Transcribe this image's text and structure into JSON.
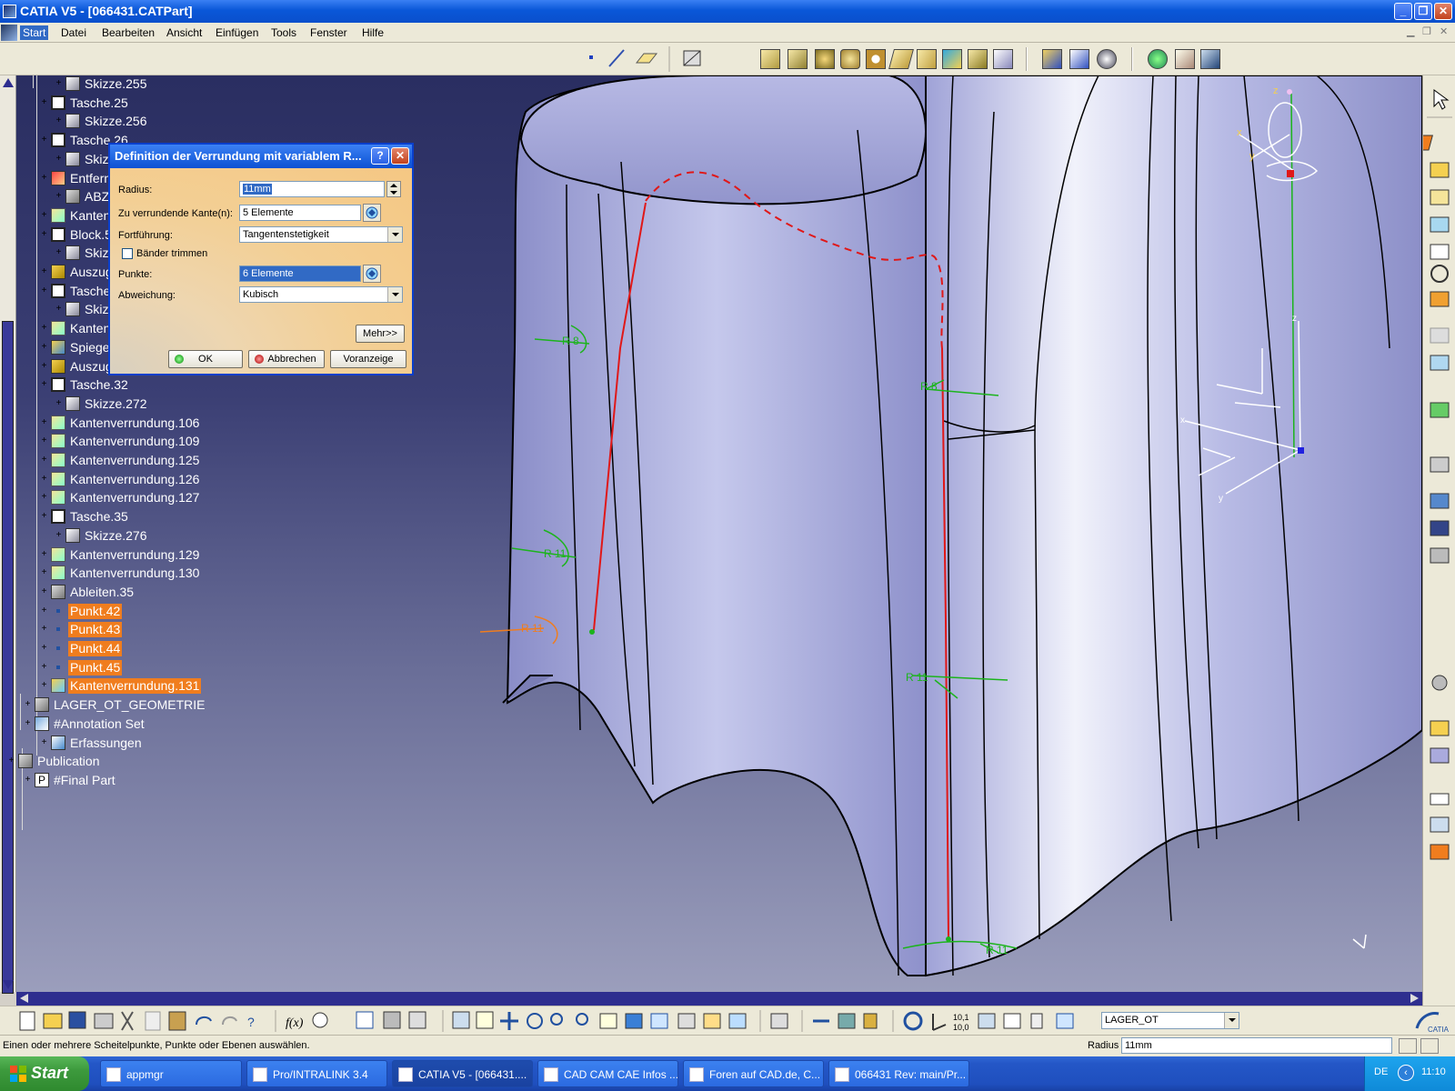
{
  "window": {
    "title": "CATIA V5 - [066431.CATPart]",
    "min": "_",
    "max": "❐",
    "close": "✕"
  },
  "menu": {
    "items": [
      "Start",
      "Datei",
      "Bearbeiten",
      "Ansicht",
      "Einfügen",
      "Tools",
      "Fenster",
      "Hilfe"
    ]
  },
  "tree": {
    "nodes": [
      {
        "label": "Skizze.255",
        "selected": false
      },
      {
        "label": "Tasche.25",
        "selected": false
      },
      {
        "label": "Skizze.256",
        "selected": false
      },
      {
        "label": "Tasche.26",
        "selected": false
      },
      {
        "label": "Skizze",
        "selected": false
      },
      {
        "label": "Entfern",
        "selected": false
      },
      {
        "label": "ABZU",
        "selected": false
      },
      {
        "label": "Kanten",
        "selected": false
      },
      {
        "label": "Block.5",
        "selected": false
      },
      {
        "label": "Skizz",
        "selected": false
      },
      {
        "label": "Auszug",
        "selected": false
      },
      {
        "label": "Tasche",
        "selected": false
      },
      {
        "label": "Skizz",
        "selected": false
      },
      {
        "label": "Kanten",
        "selected": false
      },
      {
        "label": "Spiegel",
        "selected": false
      },
      {
        "label": "Auszug",
        "selected": false
      },
      {
        "label": "Tasche.32",
        "selected": false
      },
      {
        "label": "Skizze.272",
        "selected": false
      },
      {
        "label": "Kantenverrundung.106",
        "selected": false
      },
      {
        "label": "Kantenverrundung.109",
        "selected": false
      },
      {
        "label": "Kantenverrundung.125",
        "selected": false
      },
      {
        "label": "Kantenverrundung.126",
        "selected": false
      },
      {
        "label": "Kantenverrundung.127",
        "selected": false
      },
      {
        "label": "Tasche.35",
        "selected": false
      },
      {
        "label": "Skizze.276",
        "selected": false
      },
      {
        "label": "Kantenverrundung.129",
        "selected": false
      },
      {
        "label": "Kantenverrundung.130",
        "selected": false
      },
      {
        "label": "Ableiten.35",
        "selected": false
      },
      {
        "label": "Punkt.42",
        "selected": true
      },
      {
        "label": "Punkt.43",
        "selected": true
      },
      {
        "label": "Punkt.44",
        "selected": true
      },
      {
        "label": "Punkt.45",
        "selected": true
      },
      {
        "label": "Kantenverrundung.131",
        "selected": true
      },
      {
        "label": "LAGER_OT_GEOMETRIE",
        "selected": false
      },
      {
        "label": "#Annotation Set",
        "selected": false
      },
      {
        "label": "Erfassungen",
        "selected": false
      },
      {
        "label": "Publication",
        "selected": false
      },
      {
        "label": "#Final Part",
        "selected": false
      }
    ]
  },
  "dialog": {
    "title": "Definition der Verrundung mit variablem R...",
    "help": "?",
    "close": "✕",
    "radius_label": "Radius:",
    "radius_value": "11mm",
    "edges_label": "Zu verrundende Kante(n):",
    "edges_value": "5 Elemente",
    "continuation_label": "Fortführung:",
    "continuation_value": "Tangentenstetigkeit",
    "trim_label": "Bänder trimmen",
    "points_label": "Punkte:",
    "points_value": "6 Elemente",
    "deviation_label": "Abweichung:",
    "deviation_value": "Kubisch",
    "more_button": "Mehr>>",
    "ok_button": "OK",
    "cancel_button": "Abbrechen",
    "preview_button": "Voranzeige"
  },
  "viewport": {
    "annotations": [
      "R 8",
      "R 11",
      "R 11",
      "R 8",
      "R 11",
      "R 11"
    ],
    "compass_labels": {
      "z": "z",
      "x": "x",
      "y": "y"
    },
    "axis_labels": {
      "z": "z",
      "x": "x",
      "y": "y"
    }
  },
  "bottom_toolbar": {
    "layer": "LAGER_OT"
  },
  "status": {
    "message": "Einen oder mehrere Scheitelpunkte, Punkte oder Ebenen auswählen.",
    "radius_label": "Radius",
    "radius_value": "11mm"
  },
  "taskbar": {
    "start": "Start",
    "tasks": [
      "appmgr",
      "Pro/INTRALINK 3.4",
      "CATIA V5 - [066431....",
      "CAD CAM CAE Infos ...",
      "Foren auf CAD.de, C...",
      "066431 Rev: main/Pr..."
    ],
    "language": "DE",
    "time": "11:10"
  },
  "colors": {
    "accent_selection": "#f07d1e",
    "dialog_background": "#f2c78a",
    "fillet_curve": "#e01818",
    "annotation_green": "#1cb41c"
  }
}
